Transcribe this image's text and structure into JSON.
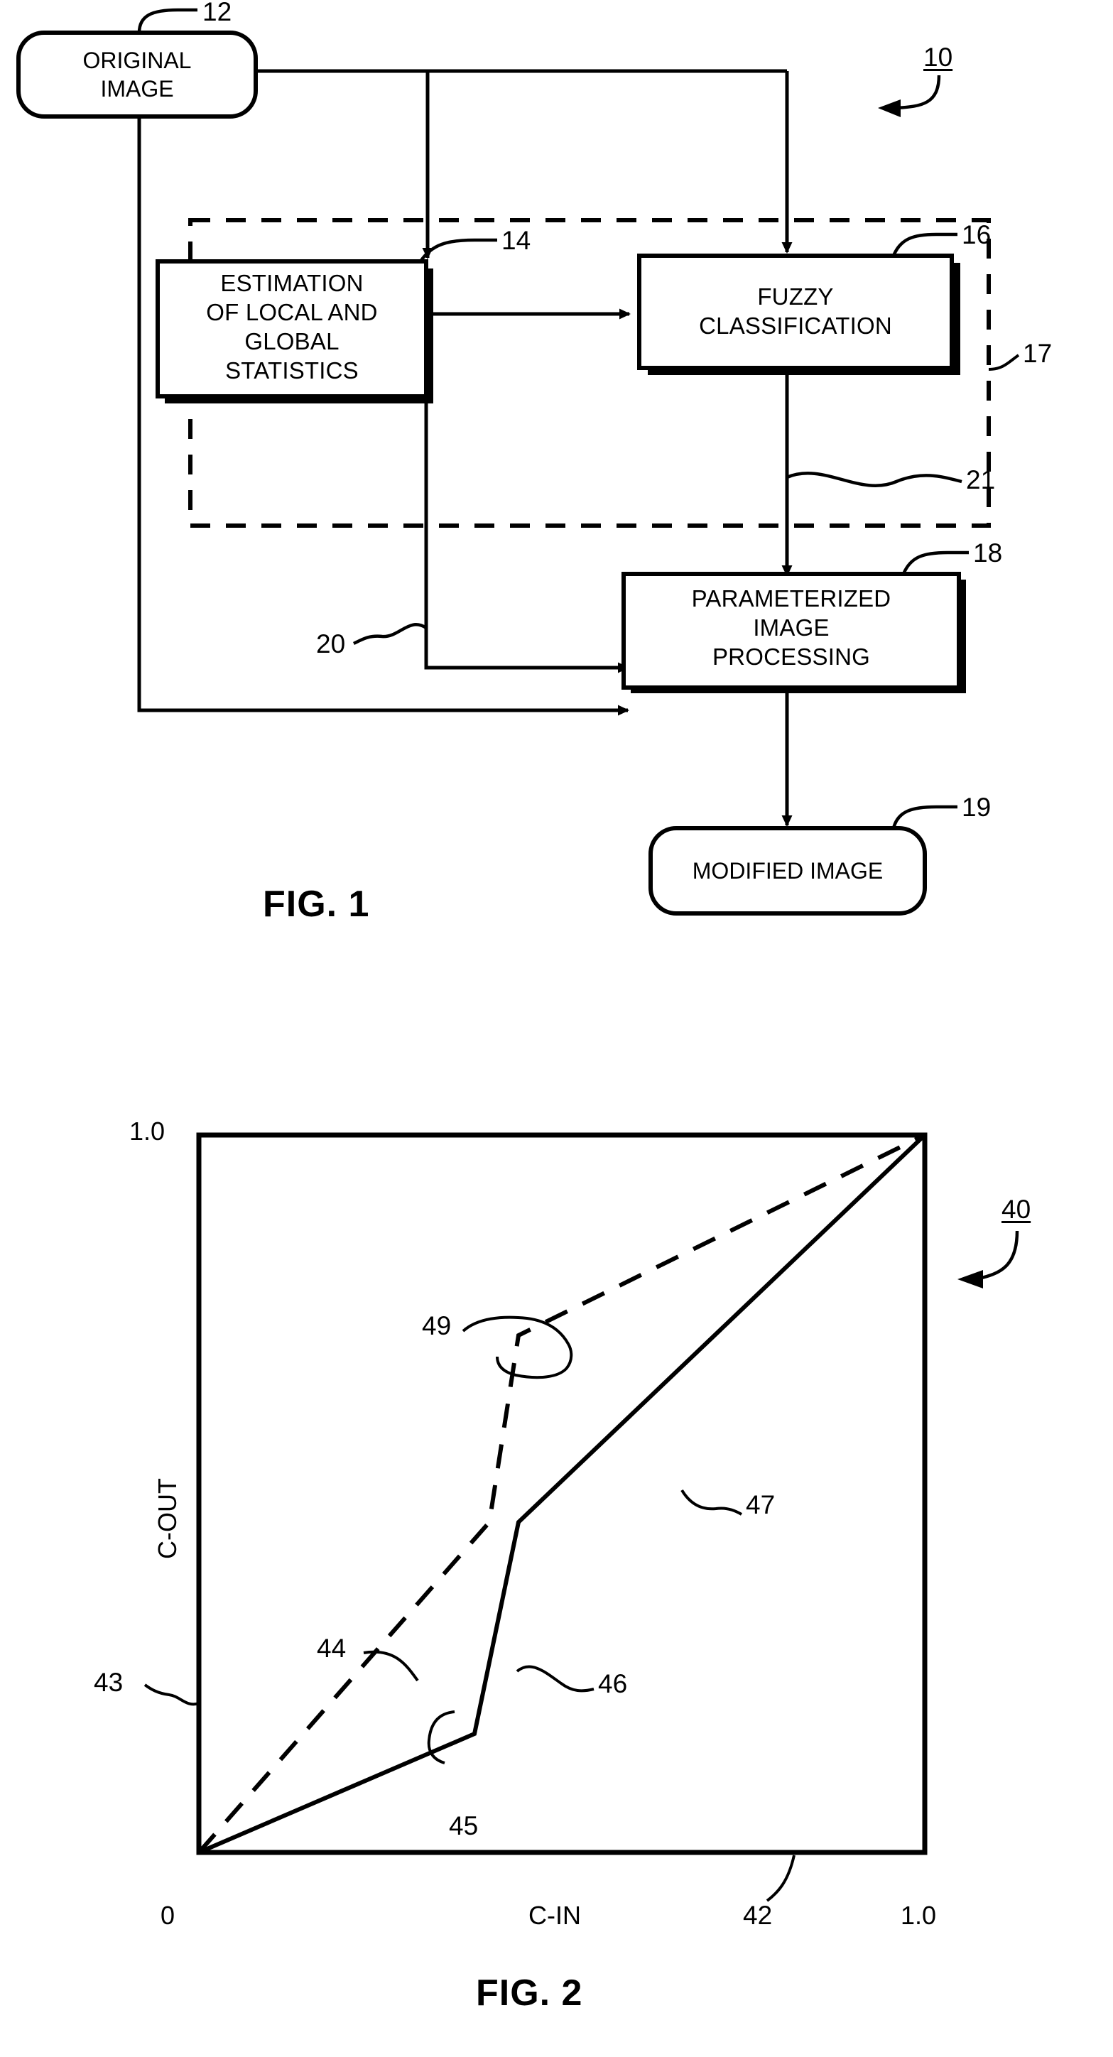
{
  "figure1": {
    "title": "FIG. 1",
    "system_ref": "10",
    "nodes": {
      "original_image": {
        "label": "ORIGINAL\nIMAGE",
        "ref": "12"
      },
      "estimation": {
        "label": "ESTIMATION\nOF LOCAL AND\nGLOBAL\nSTATISTICS",
        "ref": "14"
      },
      "fuzzy": {
        "label": "FUZZY\nCLASSIFICATION",
        "ref": "16"
      },
      "processing": {
        "label": "PARAMETERIZED\nIMAGE\nPROCESSING",
        "ref": "18"
      },
      "modified_image": {
        "label": "MODIFIED IMAGE",
        "ref": "19"
      }
    },
    "connector_refs": {
      "dashed_group": "17",
      "fuzzy_output": "21",
      "statistics_output": "20"
    }
  },
  "figure2": {
    "title": "FIG. 2",
    "system_ref": "40",
    "axis_refs": {
      "x_axis": "42",
      "y_axis": "43"
    },
    "curve_refs": {
      "dashed_line": "44",
      "solid_lower_segment": "45",
      "solid_steep_segment": "46",
      "solid_upper_segment": "47",
      "dashed_upper_knee": "49"
    },
    "chart_data": {
      "type": "line",
      "title": "FIG. 2",
      "xlabel": "C-IN",
      "ylabel": "C-OUT",
      "xlim": [
        0,
        1.0
      ],
      "ylim": [
        0,
        1.0
      ],
      "xticks": [
        "0",
        "1.0"
      ],
      "yticks": [
        "1.0"
      ],
      "grid": false,
      "legend": false,
      "series": [
        {
          "name": "44",
          "style": "dashed",
          "comment": "piecewise dashed transfer curve, identity-like then knee near 0.4 rising steeply to 0.72 then shallow to 1.0",
          "x": [
            0.0,
            0.4,
            0.44,
            1.0
          ],
          "y": [
            0.0,
            0.46,
            0.72,
            1.0
          ]
        },
        {
          "name": "45/46/47",
          "style": "solid",
          "comment": "piecewise solid transfer curve, shallow to 0.38 then steep to 0.55 then identity slope to 1.0",
          "x": [
            0.0,
            0.38,
            0.44,
            1.0
          ],
          "y": [
            0.0,
            0.165,
            0.46,
            1.0
          ]
        }
      ]
    }
  }
}
